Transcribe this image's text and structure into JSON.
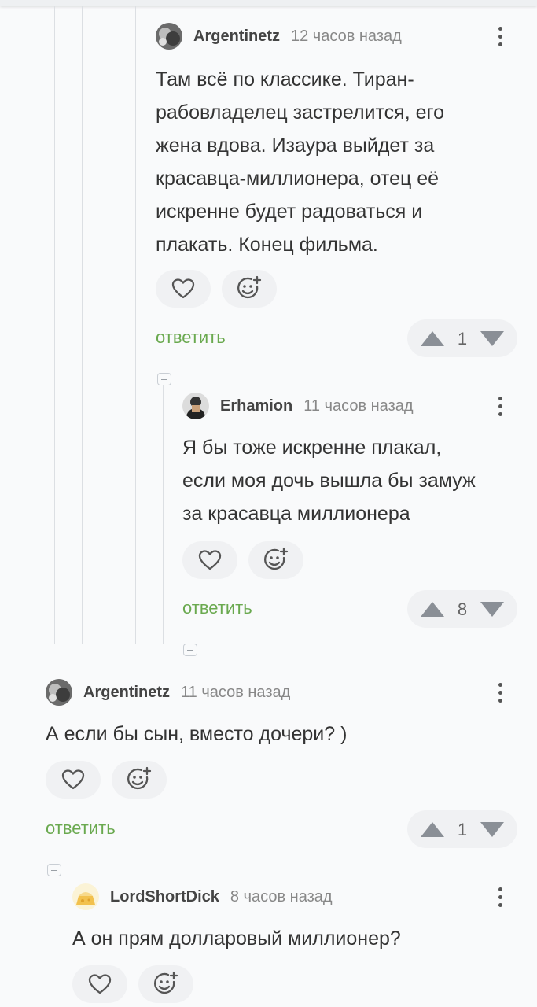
{
  "colors": {
    "reply_green": "#6aa94f",
    "thread_line": "#dcdfe3",
    "vote_bg": "#f0f1f3"
  },
  "icons": {
    "like": "heart-icon",
    "react": "smiley-add-icon",
    "menu": "more-vertical-icon",
    "collapse": "minus-square-icon"
  },
  "comments": [
    {
      "author": "Argentinetz",
      "time": "12 часов назад",
      "lines": [
        "Там всё по классике. Тиран-",
        "рабовладелец застрелится, его",
        "жена вдова. Изаура выйдет за",
        "красавца-миллионера, отец её",
        "искренне будет радоваться и",
        "плакать. Конец фильма."
      ],
      "reply_label": "ответить",
      "rating": "1"
    },
    {
      "author": "Erhamion",
      "time": "11 часов назад",
      "lines": [
        "Я бы тоже искренне плакал,",
        "если моя дочь вышла бы замуж",
        "за красавца миллионера"
      ],
      "reply_label": "ответить",
      "rating": "8"
    },
    {
      "author": "Argentinetz",
      "time": "11 часов назад",
      "lines": [
        "А если бы сын, вместо дочери? )"
      ],
      "reply_label": "ответить",
      "rating": "1"
    },
    {
      "author": "LordShortDick",
      "time": "8 часов назад",
      "lines": [
        "А он прям долларовый миллионер?"
      ]
    }
  ]
}
